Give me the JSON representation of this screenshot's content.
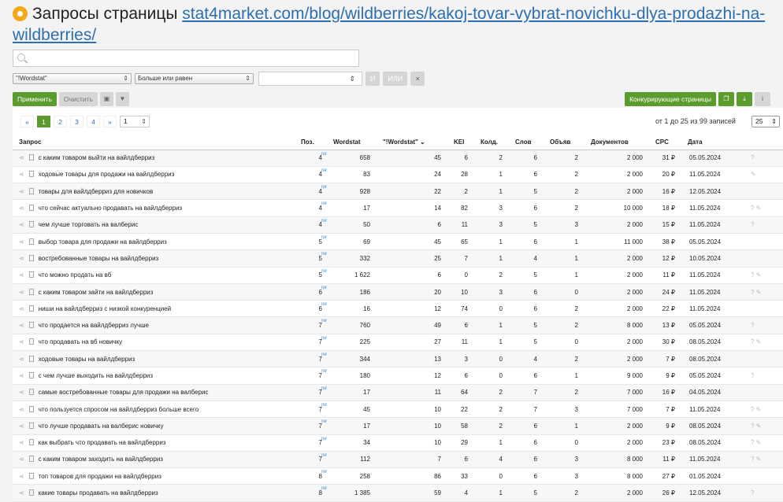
{
  "title": "Запросы страницы",
  "url": "stat4market.com/blog/wildberries/kakoj-tovar-vybrat-novichku-dlya-prodazhi-na-wildberries/",
  "filters": {
    "field": "\"!Wordstat\"",
    "operator": "Больше или равен",
    "value": "",
    "and_label": "И",
    "or_label": "ИЛИ",
    "remove_label": "×"
  },
  "actions": {
    "apply": "Применить",
    "clear": "Очистить",
    "competitors": "Конкурирующие страницы"
  },
  "pager": {
    "prev": "«",
    "pages": [
      "1",
      "2",
      "3",
      "4"
    ],
    "next": "»",
    "page_input": "1",
    "count_text": "от 1 до 25 из 99 записей",
    "per_page": "25"
  },
  "columns": [
    "Запрос",
    "Поз.",
    "Wordstat",
    "\"!Wordstat\"",
    "KEI",
    "Колд.",
    "Слов",
    "Объяв",
    "Документов",
    "CPC",
    "Дата",
    ""
  ],
  "new_badge": "new",
  "rows": [
    {
      "q": "с каким товаром выйти на вайлдберриз",
      "pos": "4",
      "ws": "658",
      "ews": "45",
      "kei": "6",
      "kold": "2",
      "slov": "6",
      "obyav": "2",
      "docs": "2 000",
      "cpc": "31 ₽",
      "date": "05.05.2024",
      "icons": "?"
    },
    {
      "q": "ходовые товары для продажи на вайлдберриз",
      "pos": "4",
      "ws": "83",
      "ews": "24",
      "kei": "28",
      "kold": "1",
      "slov": "6",
      "obyav": "2",
      "docs": "2 000",
      "cpc": "20 ₽",
      "date": "11.05.2024",
      "icons": "✎"
    },
    {
      "q": "товары для вайлдберриз для новичков",
      "pos": "4",
      "ws": "928",
      "ews": "22",
      "kei": "2",
      "kold": "1",
      "slov": "5",
      "obyav": "2",
      "docs": "2 000",
      "cpc": "16 ₽",
      "date": "12.05.2024",
      "icons": ""
    },
    {
      "q": "что сейчас актуально продавать на вайлдберриз",
      "pos": "4",
      "ws": "17",
      "ews": "14",
      "kei": "82",
      "kold": "3",
      "slov": "6",
      "obyav": "2",
      "docs": "10 000",
      "cpc": "18 ₽",
      "date": "11.05.2024",
      "icons": "? ✎"
    },
    {
      "q": "чем лучше торговать на валберис",
      "pos": "4",
      "ws": "50",
      "ews": "6",
      "kei": "11",
      "kold": "3",
      "slov": "5",
      "obyav": "3",
      "docs": "2 000",
      "cpc": "15 ₽",
      "date": "11.05.2024",
      "icons": "?"
    },
    {
      "q": "выбор товара для продажи на вайлдберриз",
      "pos": "5",
      "ws": "69",
      "ews": "45",
      "kei": "65",
      "kold": "1",
      "slov": "6",
      "obyav": "1",
      "docs": "11 000",
      "cpc": "38 ₽",
      "date": "05.05.2024",
      "icons": ""
    },
    {
      "q": "востребованные товары на вайлдберриз",
      "pos": "5",
      "ws": "332",
      "ews": "25",
      "kei": "7",
      "kold": "1",
      "slov": "4",
      "obyav": "1",
      "docs": "2 000",
      "cpc": "12 ₽",
      "date": "10.05.2024",
      "icons": ""
    },
    {
      "q": "что можно продать на вб",
      "pos": "5",
      "ws": "1 622",
      "ews": "6",
      "kei": "0",
      "kold": "2",
      "slov": "5",
      "obyav": "1",
      "docs": "2 000",
      "cpc": "11 ₽",
      "date": "11.05.2024",
      "icons": "? ✎"
    },
    {
      "q": "с каким товаром зайти на вайлдберриз",
      "pos": "6",
      "ws": "186",
      "ews": "20",
      "kei": "10",
      "kold": "3",
      "slov": "6",
      "obyav": "0",
      "docs": "2 000",
      "cpc": "24 ₽",
      "date": "11.05.2024",
      "icons": "? ✎"
    },
    {
      "q": "ниши на вайлдберриз с низкой конкуренцией",
      "pos": "6",
      "ws": "16",
      "ews": "12",
      "kei": "74",
      "kold": "0",
      "slov": "6",
      "obyav": "2",
      "docs": "2 000",
      "cpc": "22 ₽",
      "date": "11.05.2024",
      "icons": ""
    },
    {
      "q": "что продается на вайлдберриз лучше",
      "pos": "7",
      "ws": "760",
      "ews": "49",
      "kei": "6",
      "kold": "1",
      "slov": "5",
      "obyav": "2",
      "docs": "8 000",
      "cpc": "13 ₽",
      "date": "05.05.2024",
      "icons": "?"
    },
    {
      "q": "что продавать на вб новичку",
      "pos": "7",
      "ws": "225",
      "ews": "27",
      "kei": "11",
      "kold": "1",
      "slov": "5",
      "obyav": "0",
      "docs": "2 000",
      "cpc": "30 ₽",
      "date": "08.05.2024",
      "icons": "? ✎"
    },
    {
      "q": "ходовые товары на вайлдберриз",
      "pos": "7",
      "ws": "344",
      "ews": "13",
      "kei": "3",
      "kold": "0",
      "slov": "4",
      "obyav": "2",
      "docs": "2 000",
      "cpc": "7 ₽",
      "date": "08.05.2024",
      "icons": ""
    },
    {
      "q": "с чем лучше выходить на вайлдберриз",
      "pos": "7",
      "ws": "180",
      "ews": "12",
      "kei": "6",
      "kold": "0",
      "slov": "6",
      "obyav": "1",
      "docs": "9 000",
      "cpc": "9 ₽",
      "date": "05.05.2024",
      "icons": "?"
    },
    {
      "q": "самые востребованные товары для продажи на валберис",
      "pos": "7",
      "ws": "17",
      "ews": "11",
      "kei": "64",
      "kold": "2",
      "slov": "7",
      "obyav": "2",
      "docs": "7 000",
      "cpc": "16 ₽",
      "date": "04.05.2024",
      "icons": ""
    },
    {
      "q": "что пользуется спросом на вайлдберриз больше всего",
      "pos": "7",
      "ws": "45",
      "ews": "10",
      "kei": "22",
      "kold": "2",
      "slov": "7",
      "obyav": "3",
      "docs": "7 000",
      "cpc": "7 ₽",
      "date": "11.05.2024",
      "icons": "? ✎"
    },
    {
      "q": "что лучше продавать на валберис новичку",
      "pos": "7",
      "ws": "17",
      "ews": "10",
      "kei": "58",
      "kold": "2",
      "slov": "6",
      "obyav": "1",
      "docs": "2 000",
      "cpc": "9 ₽",
      "date": "08.05.2024",
      "icons": "? ✎"
    },
    {
      "q": "как выбрать что продавать на вайлдберриз",
      "pos": "7",
      "ws": "34",
      "ews": "10",
      "kei": "29",
      "kold": "1",
      "slov": "6",
      "obyav": "0",
      "docs": "2 000",
      "cpc": "23 ₽",
      "date": "08.05.2024",
      "icons": "? ✎"
    },
    {
      "q": "с каким товаром заходить на вайлдберриз",
      "pos": "7",
      "ws": "112",
      "ews": "7",
      "kei": "6",
      "kold": "4",
      "slov": "6",
      "obyav": "3",
      "docs": "8 000",
      "cpc": "11 ₽",
      "date": "11.05.2024",
      "icons": "? ✎"
    },
    {
      "q": "топ товаров для продажи на вайлдберриз",
      "pos": "8",
      "ws": "258",
      "ews": "86",
      "kei": "33",
      "kold": "0",
      "slov": "6",
      "obyav": "3",
      "docs": "8 000",
      "cpc": "27 ₽",
      "date": "01.05.2024",
      "icons": ""
    },
    {
      "q": "какие товары продавать на вайлдберриз",
      "pos": "8",
      "ws": "1 385",
      "ews": "59",
      "kei": "4",
      "kold": "1",
      "slov": "5",
      "obyav": "2",
      "docs": "2 000",
      "cpc": "26 ₽",
      "date": "12.05.2024",
      "icons": "?"
    }
  ]
}
